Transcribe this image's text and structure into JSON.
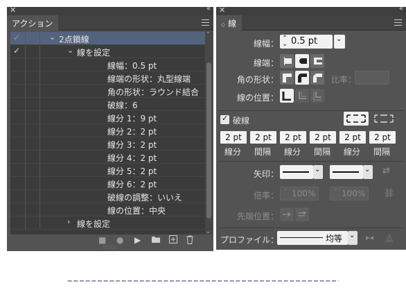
{
  "actions_panel": {
    "tab_label": "アクション",
    "rows": [
      {
        "check": "✓",
        "check_dim": true,
        "arrow": "⌄",
        "indent": 70,
        "text": "2点鎖線",
        "selected": true
      },
      {
        "check": "✓",
        "check_dim": false,
        "arrow": "⌄",
        "indent": 96,
        "text": "線を設定",
        "selected": false
      },
      {
        "check": "",
        "arrow": "",
        "indent": 140,
        "text": "線幅：0.5 pt"
      },
      {
        "check": "",
        "arrow": "",
        "indent": 140,
        "text": "線端の形状：丸型線端"
      },
      {
        "check": "",
        "arrow": "",
        "indent": 140,
        "text": "角の形状：ラウンド結合"
      },
      {
        "check": "",
        "arrow": "",
        "indent": 140,
        "text": "破線：6"
      },
      {
        "check": "",
        "arrow": "",
        "indent": 140,
        "text": "線分 1：9 pt"
      },
      {
        "check": "",
        "arrow": "",
        "indent": 140,
        "text": "線分 2：2 pt"
      },
      {
        "check": "",
        "arrow": "",
        "indent": 140,
        "text": "線分 3：2 pt"
      },
      {
        "check": "",
        "arrow": "",
        "indent": 140,
        "text": "線分 4：2 pt"
      },
      {
        "check": "",
        "arrow": "",
        "indent": 140,
        "text": "線分 5：2 pt"
      },
      {
        "check": "",
        "arrow": "",
        "indent": 140,
        "text": "線分 6：2 pt"
      },
      {
        "check": "",
        "arrow": "",
        "indent": 140,
        "text": "破線の調整：いいえ"
      },
      {
        "check": "",
        "arrow": "",
        "indent": 140,
        "text": "線の位置：中央"
      },
      {
        "check": "",
        "arrow": "›",
        "indent": 96,
        "text": "線を設定"
      }
    ],
    "toolbar_icons": [
      "stop-icon",
      "record-icon",
      "play-icon",
      "folder-icon",
      "new-action-icon",
      "trash-icon"
    ]
  },
  "stroke_panel": {
    "tab_label": "線",
    "weight_label": "線幅：",
    "weight_value": "0.5 pt",
    "cap_label": "線端：",
    "corner_label": "角の形状：",
    "limit_label": "比率：",
    "align_label": "線の位置：",
    "dashed_label": "破線",
    "dashed_checked": true,
    "dash_values": [
      "2 pt",
      "2 pt",
      "2 pt",
      "2 pt",
      "2 pt",
      "2 pt"
    ],
    "dash_labels": [
      "線分",
      "間隔",
      "線分",
      "間隔",
      "線分",
      "間隔"
    ],
    "arrow_label": "矢印：",
    "scale_label": "倍率：",
    "scale_value_1": "100%",
    "scale_value_2": "100%",
    "arrow_align_label": "先端位置：",
    "profile_label": "プロファイル：",
    "profile_value": "均等"
  },
  "colors": {
    "panel_bg": "#535353",
    "selected_row": "#54637d",
    "dashed_line": "#1a2f66"
  }
}
